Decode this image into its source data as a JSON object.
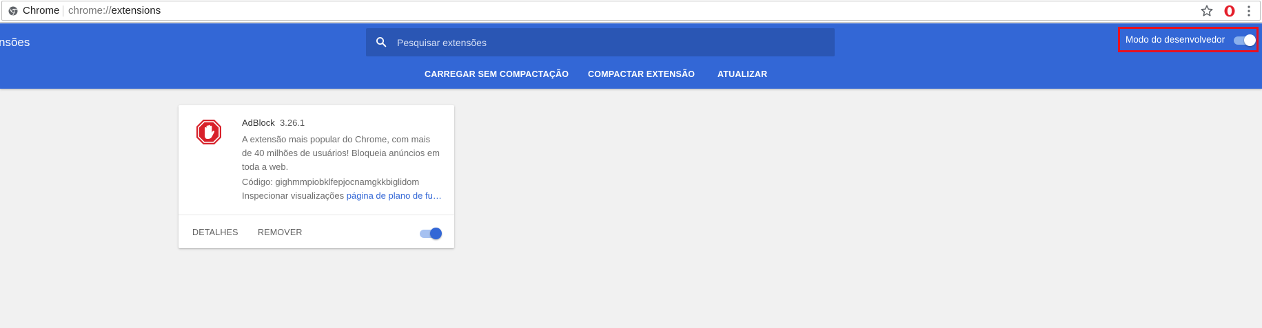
{
  "browser": {
    "site_name": "Chrome",
    "url_scheme": "chrome://",
    "url_path": "extensions",
    "icons": [
      "chrome-site-icon",
      "star-icon",
      "opera-icon",
      "kebab-menu-icon"
    ]
  },
  "header": {
    "title": "nsões",
    "search_placeholder": "Pesquisar extensões",
    "dev_mode_label": "Modo do desenvolvedor",
    "dev_mode_on": true,
    "actions": {
      "load_unpacked": "CARREGAR SEM COMPACTAÇÃO",
      "pack_extension": "COMPACTAR EXTENSÃO",
      "update": "ATUALIZAR"
    }
  },
  "extension": {
    "name": "AdBlock",
    "version": "3.26.1",
    "description": "A extensão mais popular do Chrome, com mais de 40 milhões de usuários! Bloqueia anúncios em toda a web.",
    "id_text": "Código: gighmmpiobklfepjocnamgkkbiglidom",
    "inspect_label": "Inspecionar visualizações",
    "inspect_link": "página de plano de fu…",
    "details_label": "DETALHES",
    "remove_label": "REMOVER",
    "enabled": true
  },
  "colors": {
    "header": "#3367d6",
    "search_bg": "#2a56b4",
    "accent": "#3367d6",
    "highlight_box": "#e8111f",
    "page_bg": "#f1f1f1"
  }
}
